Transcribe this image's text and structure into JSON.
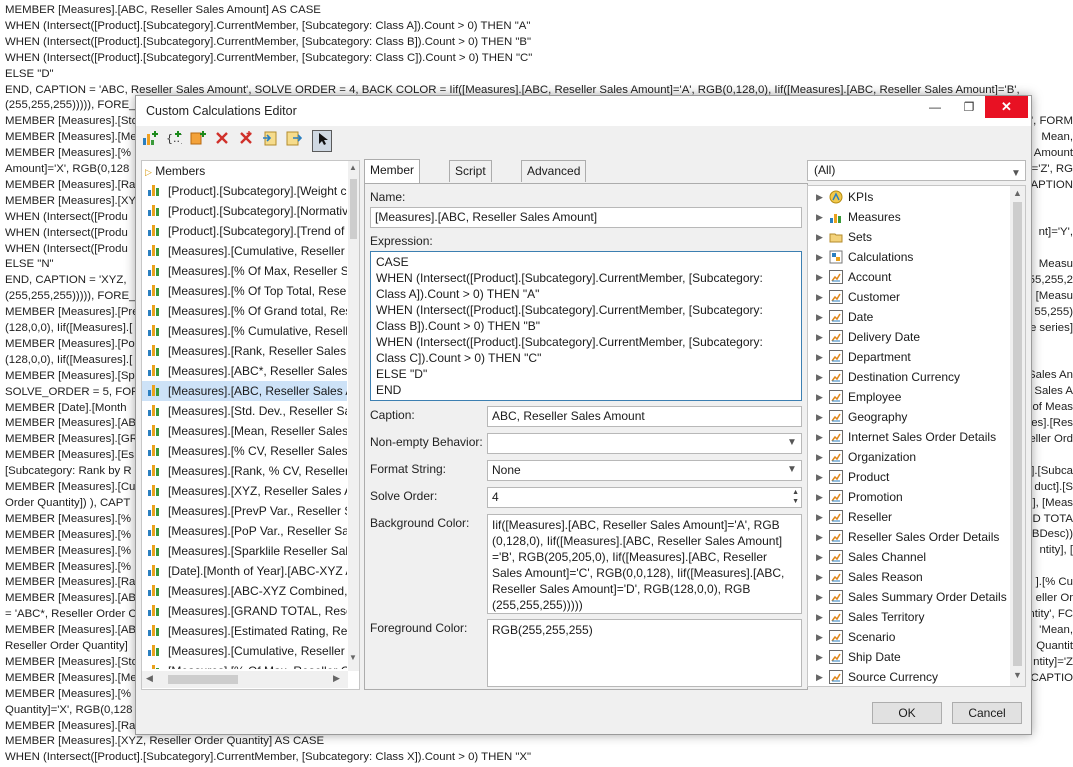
{
  "background": {
    "lines": [
      "MEMBER [Measures].[ABC, Reseller Sales Amount] AS CASE",
      "WHEN (Intersect([Product].[Subcategory].CurrentMember, [Subcategory: Class A]).Count > 0) THEN \"A\"",
      "WHEN (Intersect([Product].[Subcategory].CurrentMember, [Subcategory: Class B]).Count > 0) THEN \"B\"",
      "WHEN (Intersect([Product].[Subcategory].CurrentMember, [Subcategory: Class C]).Count > 0) THEN \"C\"",
      "ELSE \"D\"",
      "END, CAPTION = 'ABC, Reseller Sales Amount', SOLVE ORDER = 4, BACK COLOR = Iif([Measures].[ABC, Reseller Sales Amount]='A', RGB(0,128,0), Iif([Measures].[ABC, Reseller Sales Amount]='B',",
      "(255,255,255))))), FORE_C",
      "MEMBER [Measures].[Sto",
      "MEMBER [Measures].[Me",
      "MEMBER [Measures].[%",
      "Amount]='X', RGB(0,128",
      "MEMBER [Measures].[Ra",
      "MEMBER [Measures].[XY",
      "WHEN (Intersect([Produ",
      "WHEN (Intersect([Produ",
      "WHEN (Intersect([Produ",
      "ELSE \"N\"",
      "END, CAPTION = 'XYZ,",
      "(255,255,255))))), FORE_C",
      "MEMBER [Measures].[Pre",
      "(128,0,0), Iif([Measures].[",
      "MEMBER [Measures].[Po",
      "(128,0,0), Iif([Measures].[",
      "MEMBER [Measures].[Sp",
      "SOLVE_ORDER = 5, FORI",
      "MEMBER [Date].[Month",
      "MEMBER [Measures].[AB",
      "MEMBER [Measures].[GR",
      "MEMBER [Measures].[Es",
      "[Subcategory: Rank by R",
      "MEMBER [Measures].[Cu",
      "Order Quantity]) ), CAPT",
      "MEMBER [Measures].[%",
      "MEMBER [Measures].[%",
      "MEMBER [Measures].[%",
      "MEMBER [Measures].[%",
      "MEMBER [Measures].[Ra",
      "MEMBER [Measures].[AB",
      "= 'ABC*, Reseller Order C",
      "MEMBER [Measures].[AB",
      "Reseller Order Quantity]",
      "MEMBER [Measures].[Sto",
      "MEMBER [Measures].[Me",
      "MEMBER [Measures].[%",
      "Quantity]='X', RGB(0,128",
      "MEMBER [Measures].[Ra",
      "MEMBER [Measures].[XYZ, Reseller Order Quantity] AS CASE",
      "WHEN (Intersect([Product].[Subcategory].CurrentMember, [Subcategory: Class X]).Count > 0) THEN \"X\""
    ],
    "right_lines": [
      "', FORM",
      "Mean,",
      "Amount",
      "]='Z', RG",
      "CAPTION",
      "",
      "",
      "nt]='Y',",
      "",
      "Measu",
      "55,255,2",
      "[Measu",
      "55,255)",
      "e series]",
      "",
      "",
      "Sales An",
      "r Sales A",
      "of Meas",
      "es].[Res",
      "eller Ord",
      "",
      "].[Subca",
      "duct].[S",
      "], [Meas",
      "ND TOTA",
      "BDesc))",
      "ntity], [",
      "",
      "].[% Cu",
      "eller Or",
      "ntity', FC",
      "'Mean,",
      "Quantit",
      "ntity]='Z",
      ", CAPTIO"
    ]
  },
  "dialog": {
    "title": "Custom Calculations Editor",
    "minimize": "—",
    "maximize": "❐",
    "close": "✕"
  },
  "toolbar": {
    "items": [
      "add-member",
      "add-set",
      "add-calculation",
      "delete",
      "delete-all",
      "import",
      "export",
      "select-mode"
    ]
  },
  "members": {
    "header": "Members",
    "items": [
      "[Product].[Subcategory].[Weight c",
      "[Product].[Subcategory].[Normativ",
      "[Product].[Subcategory].[Trend of",
      "[Measures].[Cumulative, Reseller S",
      "[Measures].[% Of Max, Reseller Sa",
      "[Measures].[% Of Top Total, Resell",
      "[Measures].[% Of Grand total, Res",
      "[Measures].[% Cumulative, Reselle",
      "[Measures].[Rank, Reseller Sales A",
      "[Measures].[ABC*, Reseller Sales A",
      "[Measures].[ABC, Reseller Sales Ar",
      "[Measures].[Std. Dev., Reseller Sale",
      "[Measures].[Mean, Reseller Sales A",
      "[Measures].[% CV, Reseller Sales A",
      "[Measures].[Rank, % CV, Reseller S",
      "[Measures].[XYZ, Reseller Sales Ar",
      "[Measures].[PrevP Var., Reseller Sa",
      "[Measures].[PoP Var., Reseller Sale",
      "[Measures].[Sparklile Reseller Sale",
      "[Date].[Month of Year].[ABC-XYZ A",
      "[Measures].[ABC-XYZ Combined, I",
      "[Measures].[GRAND TOTAL, Resell",
      "[Measures].[Estimated Rating, Res",
      "[Measures].[Cumulative, Reseller C",
      "[Measures].[% Of Max, Reseller O"
    ],
    "selected_index": 10
  },
  "tabs": [
    "Member View",
    "Script View",
    "Advanced"
  ],
  "member_view": {
    "name_label": "Name:",
    "name_value": "[Measures].[ABC, Reseller Sales Amount]",
    "expression_label": "Expression:",
    "expression_value": "CASE\nWHEN (Intersect([Product].[Subcategory].CurrentMember, [Subcategory: Class A]).Count > 0) THEN \"A\"\nWHEN (Intersect([Product].[Subcategory].CurrentMember, [Subcategory: Class B]).Count > 0) THEN \"B\"\nWHEN (Intersect([Product].[Subcategory].CurrentMember, [Subcategory: Class C]).Count > 0) THEN \"C\"\nELSE \"D\"\nEND",
    "caption_label": "Caption:",
    "caption_value": "ABC, Reseller Sales Amount",
    "nonempty_label": "Non-empty Behavior:",
    "nonempty_value": "",
    "format_label": "Format String:",
    "format_value": "None",
    "solve_label": "Solve Order:",
    "solve_value": "4",
    "bg_label": "Background Color:",
    "bg_value": "Iif([Measures].[ABC, Reseller Sales Amount]='A', RGB (0,128,0), Iif([Measures].[ABC, Reseller Sales Amount] ='B', RGB(205,205,0), Iif([Measures].[ABC, Reseller Sales Amount]='C', RGB(0,0,128), Iif([Measures].[ABC, Reseller Sales Amount]='D', RGB(128,0,0), RGB (255,255,255)))))",
    "fg_label": "Foreground Color:",
    "fg_value": "RGB(255,255,255)"
  },
  "metadata": {
    "filter": "(All)",
    "items": [
      {
        "label": "KPIs",
        "icon": "kpi-icon"
      },
      {
        "label": "Measures",
        "icon": "measures-icon"
      },
      {
        "label": "Sets",
        "icon": "folder-icon"
      },
      {
        "label": "Calculations",
        "icon": "calculations-icon"
      },
      {
        "label": "Account",
        "icon": "dimension-icon"
      },
      {
        "label": "Customer",
        "icon": "dimension-icon"
      },
      {
        "label": "Date",
        "icon": "dimension-icon"
      },
      {
        "label": "Delivery Date",
        "icon": "dimension-icon"
      },
      {
        "label": "Department",
        "icon": "dimension-icon"
      },
      {
        "label": "Destination Currency",
        "icon": "dimension-icon"
      },
      {
        "label": "Employee",
        "icon": "dimension-icon"
      },
      {
        "label": "Geography",
        "icon": "dimension-icon"
      },
      {
        "label": "Internet Sales Order Details",
        "icon": "dimension-icon"
      },
      {
        "label": "Organization",
        "icon": "dimension-icon"
      },
      {
        "label": "Product",
        "icon": "dimension-icon"
      },
      {
        "label": "Promotion",
        "icon": "dimension-icon"
      },
      {
        "label": "Reseller",
        "icon": "dimension-icon"
      },
      {
        "label": "Reseller Sales Order Details",
        "icon": "dimension-icon"
      },
      {
        "label": "Sales Channel",
        "icon": "dimension-icon"
      },
      {
        "label": "Sales Reason",
        "icon": "dimension-icon"
      },
      {
        "label": "Sales Summary Order Details",
        "icon": "dimension-icon"
      },
      {
        "label": "Sales Territory",
        "icon": "dimension-icon"
      },
      {
        "label": "Scenario",
        "icon": "dimension-icon"
      },
      {
        "label": "Ship Date",
        "icon": "dimension-icon"
      },
      {
        "label": "Source Currency",
        "icon": "dimension-icon"
      }
    ]
  },
  "buttons": {
    "ok": "OK",
    "cancel": "Cancel"
  }
}
